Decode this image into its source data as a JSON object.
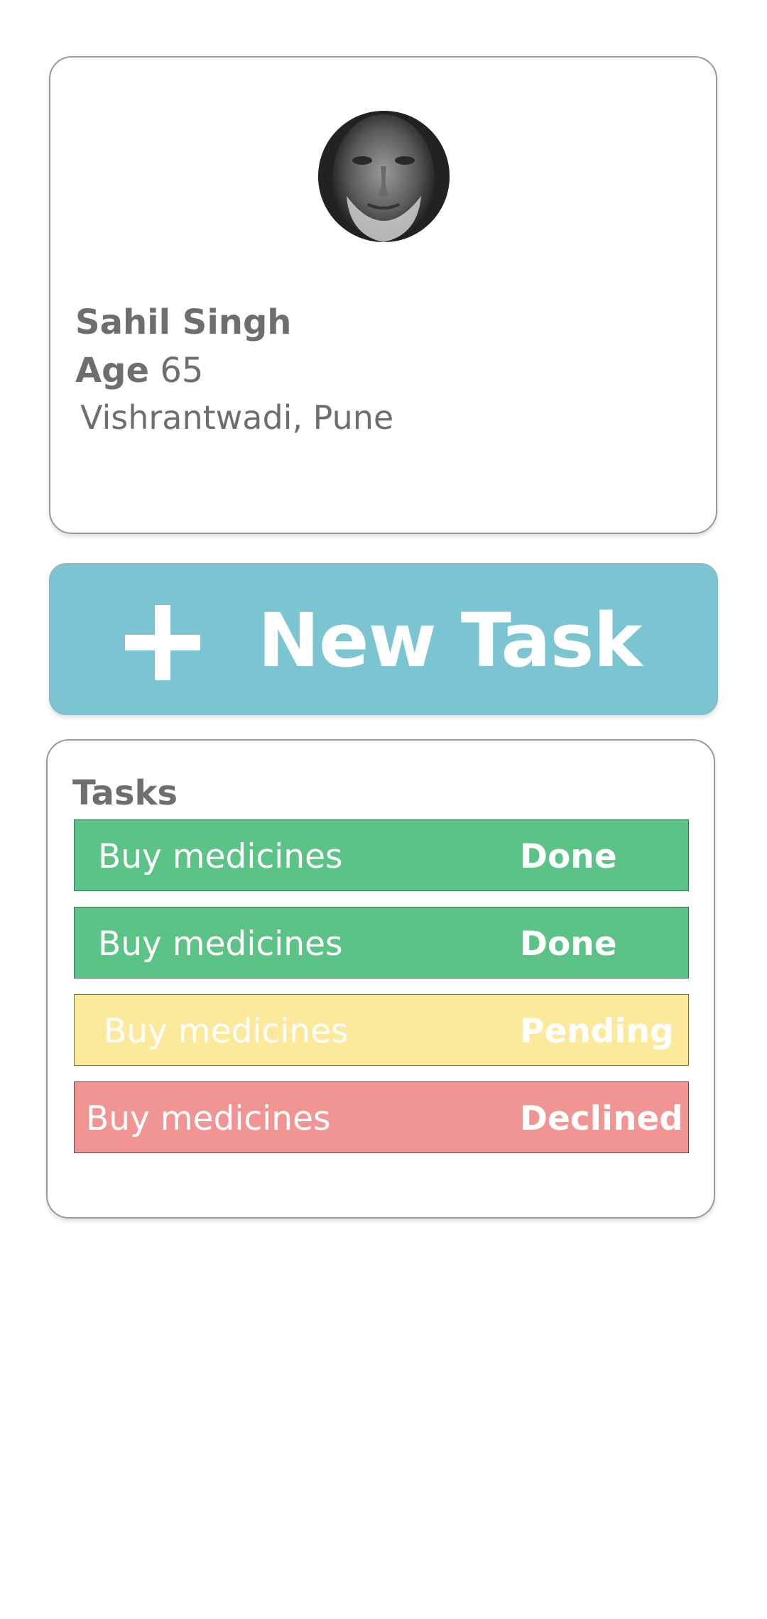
{
  "profile": {
    "name": "Sahil Singh",
    "age_label": "Age",
    "age_value": "65",
    "location": "Vishrantwadi, Pune",
    "avatar_icon": "user-photo"
  },
  "new_task": {
    "icon": "plus-icon",
    "label": "New Task",
    "color": "#7ac5d1"
  },
  "tasks": {
    "title": "Tasks",
    "items": [
      {
        "name": "Buy medicines",
        "status": "Done",
        "color": "#5cc386"
      },
      {
        "name": "Buy medicines",
        "status": "Done",
        "color": "#5cc386"
      },
      {
        "name": "Buy medicines",
        "status": "Pending",
        "color": "#fde99b"
      },
      {
        "name": "Buy medicines",
        "status": "Declined",
        "color": "#f09593"
      }
    ]
  }
}
